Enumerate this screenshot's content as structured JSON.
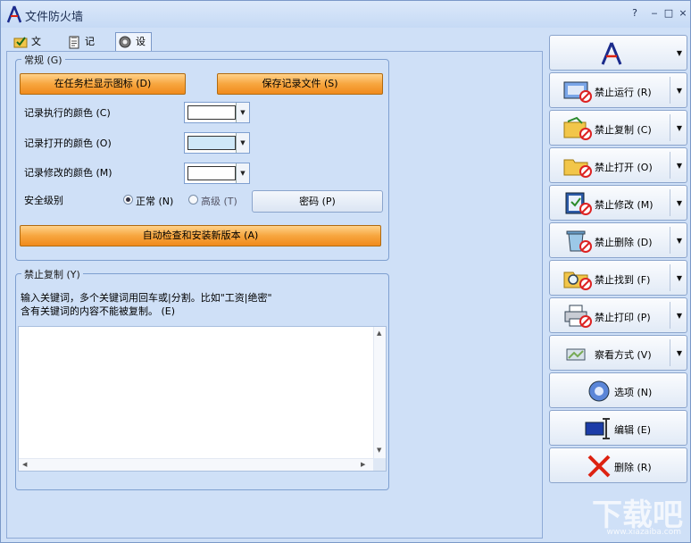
{
  "window": {
    "title": "文件防火墙",
    "buttons": {
      "help": "?",
      "minimize": "‒",
      "maximize": "□",
      "close": "×"
    }
  },
  "tabs": [
    {
      "label": "文件",
      "icon": "folder-check-icon"
    },
    {
      "label": "记录",
      "icon": "clipboard-icon"
    },
    {
      "label": "设置",
      "icon": "gear-icon"
    }
  ],
  "general": {
    "group_label": "常规 (G)",
    "btn_taskbar_icon": "在任务栏显示图标 (D)",
    "btn_save_log": "保存记录文件 (S)",
    "color_exec_label": "记录执行的颜色 (C)",
    "color_open_label": "记录打开的颜色 (O)",
    "color_modify_label": "记录修改的颜色 (M)",
    "colors": {
      "exec": "#ffffff",
      "open": "#cfe8f8",
      "modify": "#ffffff"
    },
    "security_label": "安全级别",
    "radio_normal": "正常 (N)",
    "radio_high": "高级 (T)",
    "btn_password": "密码 (P)",
    "btn_auto_update": "自动检查和安装新版本 (A)"
  },
  "no_copy": {
    "group_label": "禁止复制 (Y)",
    "desc_line1": "输入关键词，多个关键词用回车或|分割。比如\"工资|绝密\"",
    "desc_line2": "含有关键词的内容不能被复制。 (E)",
    "keywords_value": ""
  },
  "right_panel": {
    "buttons": [
      {
        "label": "禁止运行 (R)",
        "icon": "no-run-icon"
      },
      {
        "label": "禁止复制 (C)",
        "icon": "no-copy-icon"
      },
      {
        "label": "禁止打开 (O)",
        "icon": "no-open-icon"
      },
      {
        "label": "禁止修改 (M)",
        "icon": "no-modify-icon"
      },
      {
        "label": "禁止删除 (D)",
        "icon": "no-delete-icon"
      },
      {
        "label": "禁止找到 (F)",
        "icon": "no-find-icon"
      },
      {
        "label": "禁止打印 (P)",
        "icon": "no-print-icon"
      },
      {
        "label": "察看方式 (V)",
        "icon": "view-mode-icon"
      }
    ],
    "options_label": "选项 (N)",
    "edit_label": "编辑 (E)",
    "delete_label": "删除 (R)"
  },
  "watermark": {
    "main": "下载吧",
    "sub": "www.xiazaiba.com"
  }
}
